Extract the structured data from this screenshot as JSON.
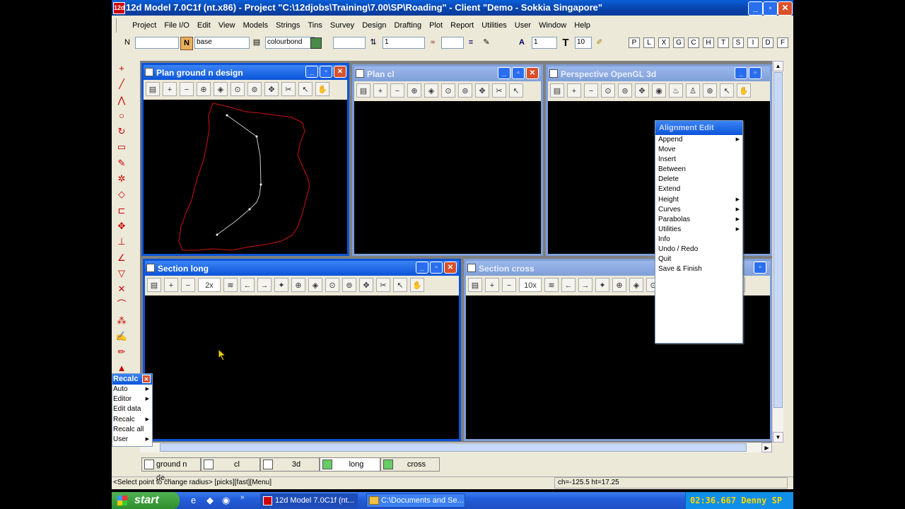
{
  "app": {
    "title": "12d Model 7.0C1f (nt.x86) - Project \"C:\\12djobs\\Training\\7.00\\SP\\Roading\" - Client \"Demo - Sokkia Singapore\"",
    "icon_text": "12d"
  },
  "menu": [
    "Project",
    "File I/O",
    "Edit",
    "View",
    "Models",
    "Strings",
    "Tins",
    "Survey",
    "Design",
    "Drafting",
    "Plot",
    "Report",
    "Utilities",
    "User",
    "Window",
    "Help"
  ],
  "toolbar": {
    "n_label": "N",
    "n_value": "",
    "model_icon": "N",
    "model_value": "base",
    "colour_value": "colourbond",
    "weight_value": "1",
    "text_style_value": "1",
    "text_size_value": "10",
    "letters": [
      "P",
      "L",
      "X",
      "G",
      "C",
      "H",
      "T",
      "S",
      "I",
      "D",
      "F"
    ]
  },
  "windows": {
    "plan_ground": {
      "title": "Plan ground n design"
    },
    "plan_cl": {
      "title": "Plan cl"
    },
    "perspective": {
      "title": "Perspective OpenGL 3d"
    },
    "section_long": {
      "title": "Section long",
      "zoom": "2x"
    },
    "section_cross": {
      "title": "Section cross",
      "zoom": "10x"
    }
  },
  "alignment_menu": {
    "title": "Alignment Edit",
    "items": [
      {
        "label": "Append",
        "sub": true
      },
      {
        "label": "Move",
        "sub": false
      },
      {
        "label": "Insert",
        "sub": false
      },
      {
        "label": "Between",
        "sub": false
      },
      {
        "label": "Delete",
        "sub": false
      },
      {
        "label": "Extend",
        "sub": false
      },
      {
        "label": "Height",
        "sub": true
      },
      {
        "label": "Curves",
        "sub": true
      },
      {
        "label": "Parabolas",
        "sub": true
      },
      {
        "label": "Utilities",
        "sub": true
      },
      {
        "label": "Info",
        "sub": false
      },
      {
        "label": "Undo /    Redo",
        "sub": false
      },
      {
        "label": "Quit",
        "sub": false
      },
      {
        "label": "Save & Finish",
        "sub": false
      }
    ]
  },
  "recalc_menu": {
    "title": "Recalc",
    "items": [
      {
        "label": "Auto",
        "sub": true
      },
      {
        "label": "Editor",
        "sub": true
      },
      {
        "label": "Edit data",
        "sub": false
      },
      {
        "label": "Recalc",
        "sub": true
      },
      {
        "label": "Recalc all",
        "sub": false
      },
      {
        "label": "User",
        "sub": true
      }
    ]
  },
  "tabs": [
    "ground n de...",
    "cl",
    "3d",
    "long",
    "cross"
  ],
  "status": {
    "prompt": "<Select point to change radius> [picks][fast][Menu]",
    "coords": "ch=-125.5 ht=17.25"
  },
  "taskbar": {
    "start": "start",
    "tasks": [
      "12d Model 7.0C1f (nt...",
      "C:\\Documents and Se..."
    ],
    "clock": "02:36.667 Denny SP"
  },
  "colors": {
    "boundary": "#d01010",
    "alignment": "#c8c8c8",
    "xp_blue": "#0b54d8"
  }
}
